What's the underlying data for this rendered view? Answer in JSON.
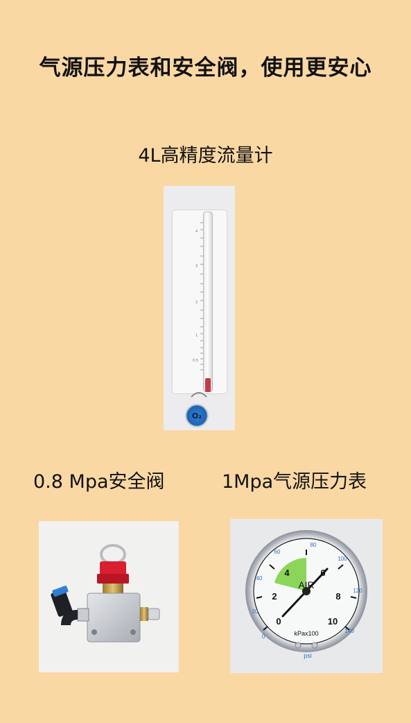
{
  "headline": "气源压力表和安全阀，使用更安心",
  "captions": {
    "flowmeter": "4L高精度流量计",
    "valve": "0.8 Mpa安全阀",
    "gauge": "1Mpa气源压力表"
  },
  "flowmeter_image": {
    "knob_label": "O₂",
    "scale_marks": [
      "4",
      "3",
      "2",
      "1",
      "0.5"
    ]
  },
  "gauge_image": {
    "center_label": "AIR",
    "unit_label": "kPax100",
    "psi_label": "psi",
    "main_scale": [
      "0",
      "2",
      "4",
      "6",
      "8",
      "10"
    ],
    "psi_scale": [
      "0",
      "20",
      "40",
      "60",
      "80",
      "100",
      "120",
      "140"
    ]
  },
  "colors": {
    "background": "#fad8a4",
    "gauge_green_zone": "#8bd65a",
    "valve_cap": "#d8202e",
    "knob_blue": "#2f7fd6"
  }
}
